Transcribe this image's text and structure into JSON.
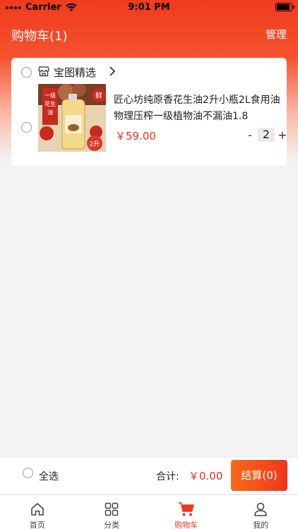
{
  "status_bar": {
    "carrier": "Carrier",
    "time": "9:01 PM"
  },
  "nav": {
    "title": "购物车(1)",
    "manage": "管理"
  },
  "shop": {
    "name": "宝图精选",
    "icon": "shop-icon"
  },
  "item": {
    "title": "匠心坊纯原香花生油2升小瓶2L食用油物理压榨一级植物油不漏油1.8",
    "price": "￥59.00",
    "quantity": "2",
    "minus": "-",
    "plus": "+",
    "image_labels": {
      "badge_fresh": "鲜",
      "side_text": "一级花生油",
      "tag_leak": "不漏油嘴",
      "tag_design": "创新设计",
      "tag_size": "2升",
      "tag_family": "家用装"
    }
  },
  "bottom_bar": {
    "select_all": "全选",
    "total_label": "合计:",
    "total_value": "￥0.00",
    "checkout": "结算(0)"
  },
  "tabs": [
    {
      "label": "首页",
      "icon": "home-icon",
      "active": false
    },
    {
      "label": "分类",
      "icon": "category-grid-icon",
      "active": false
    },
    {
      "label": "购物车",
      "icon": "cart-icon",
      "active": true
    },
    {
      "label": "我的",
      "icon": "user-icon",
      "active": false
    }
  ],
  "colors": {
    "accent": "#f0361c",
    "price": "#e8301c",
    "header": "#f03a1e"
  }
}
